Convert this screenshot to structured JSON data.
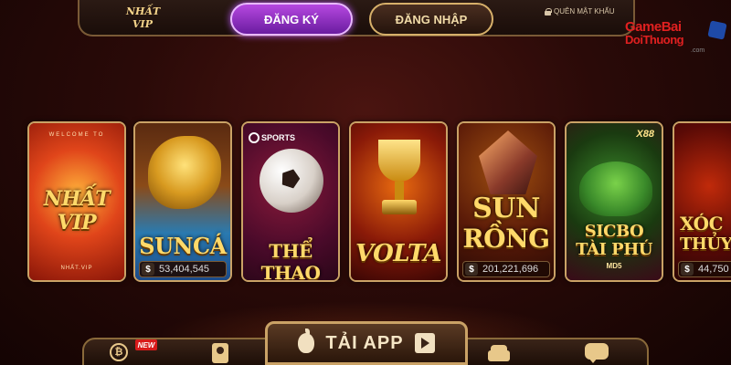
{
  "header": {
    "logo_text": "NHẤT VIP",
    "register_label": "ĐĂNG KÝ",
    "login_label": "ĐĂNG NHẬP",
    "forgot_label": "QUÊN MẬT KHẨU"
  },
  "watermark": {
    "line1": "GameBai",
    "line2": "DoiThuong",
    "suffix": ".com"
  },
  "cards": [
    {
      "name": "nhat-vip",
      "title": "NHẤT VIP",
      "top_text": "WELCOME TO",
      "bottom_text": "NHẤT.VIP"
    },
    {
      "name": "sun-ca",
      "title": "SUNCÁ",
      "jackpot": "53,404,545"
    },
    {
      "name": "the-thao",
      "title": "THỂ THAO",
      "badge": "SPORTS"
    },
    {
      "name": "volta",
      "title": "VOLTA"
    },
    {
      "name": "sun-rong",
      "title_line1": "SUN",
      "title_line2": "RỒNG",
      "jackpot": "201,221,696"
    },
    {
      "name": "sicbo",
      "title_line1": "SICBO",
      "title_line2": "TÀI PHÚ",
      "subtitle": "MD5",
      "badge": "X88"
    },
    {
      "name": "xoc-dia",
      "title_line1": "XÓC",
      "title_line2": "THỦY",
      "jackpot": "44,750"
    }
  ],
  "bottombar": {
    "new_badge": "NEW",
    "app_label": "TẢI APP",
    "btc_symbol": "₿"
  },
  "icons": {
    "btc": "bitcoin-icon",
    "contact": "contact-icon",
    "phone": "phone-icon",
    "chat": "chat-icon",
    "apple": "apple-icon",
    "play": "play-store-icon",
    "lock": "lock-icon"
  },
  "colors": {
    "register_purple": "#8a2cc0",
    "gold": "#ffd96a",
    "watermark_red": "#e02020"
  }
}
